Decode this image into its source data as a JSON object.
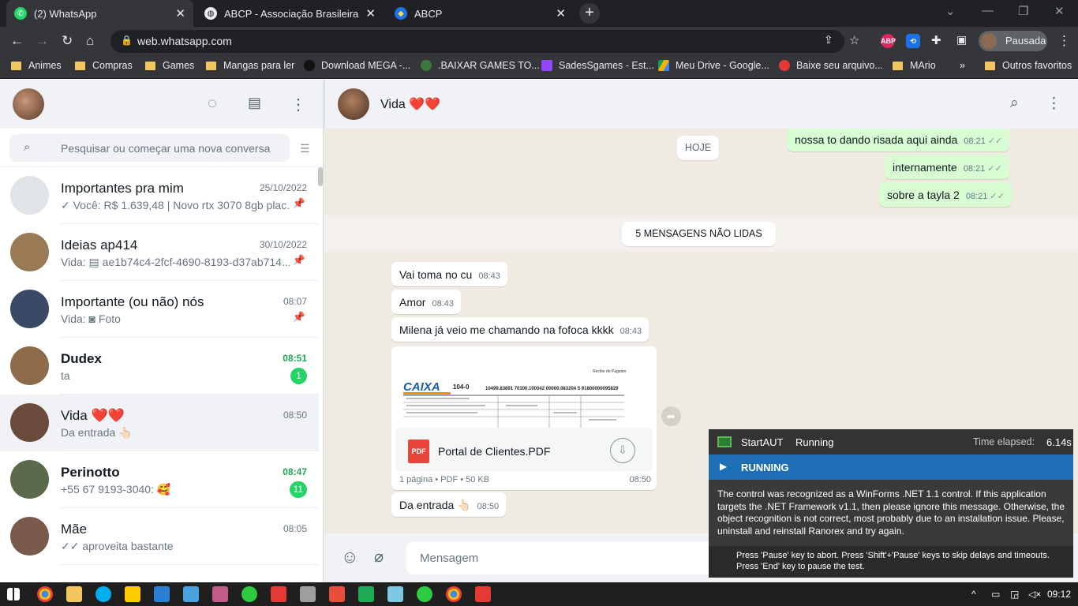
{
  "browser": {
    "tabs": [
      {
        "title": "(2) WhatsApp",
        "active": true
      },
      {
        "title": "ABCP - Associação Brasileira de Cimento",
        "active": false
      },
      {
        "title": "ABCP",
        "active": false
      }
    ],
    "url": "web.whatsapp.com",
    "profile_label": "Pausada",
    "extensions": [
      "ABP"
    ],
    "bookmarks": [
      "Animes",
      "Compras",
      "Games",
      "Mangas para ler",
      "Download MEGA -...",
      ".BAIXAR GAMES TO...",
      "SadesSgames - Est...",
      "Meu Drive - Google...",
      "Baixe seu arquivo...",
      "MArio",
      "Outros favoritos"
    ],
    "more_bookmarks": "»"
  },
  "whatsapp": {
    "search_placeholder": "Pesquisar ou começar uma nova conversa",
    "chats": [
      {
        "name": "Importantes pra mim",
        "time": "25/10/2022",
        "preview": "✓ Você: R$ 1.639,48 | Novo rtx 3070 8gb plac...",
        "pinned": true,
        "unread": null,
        "avatar_color": "#dfe5e7",
        "bold": false
      },
      {
        "name": "Ideias ap414",
        "time": "30/10/2022",
        "preview": "Vida: ▤ ae1b74c4-2fcf-4690-8193-d37ab714...",
        "pinned": true,
        "unread": null,
        "avatar_color": "#9a7a55",
        "bold": false
      },
      {
        "name": "Importante (ou não) nós",
        "time": "08:07",
        "preview": "Vida: ◙ Foto",
        "pinned": true,
        "unread": null,
        "avatar_color": "#3a4a66",
        "bold": false
      },
      {
        "name": "Dudex",
        "time": "08:51",
        "preview": "ta",
        "pinned": false,
        "unread": "1",
        "avatar_color": "#8c6a4a",
        "bold": true
      },
      {
        "name": "Vida ❤️❤️",
        "time": "08:50",
        "preview": "Da entrada 👆🏻",
        "pinned": false,
        "unread": null,
        "avatar_color": "#6a4a3a",
        "bold": false
      },
      {
        "name": "Perinotto",
        "time": "08:47",
        "preview": "+55 67 9193-3040: 🥰",
        "pinned": false,
        "unread": "11",
        "avatar_color": "#5a6a4a",
        "bold": true
      },
      {
        "name": "Mãe",
        "time": "08:05",
        "preview": "✓✓ aproveita bastante",
        "pinned": false,
        "unread": null,
        "avatar_color": "#7a5a4a",
        "bold": false
      }
    ],
    "active_chat": {
      "name": "Vida ❤️❤️",
      "date_pill": "HOJE",
      "unread_pill": "5 MENSAGENS NÃO LIDAS",
      "outgoing": [
        {
          "text": "nossa to dando risada aqui ainda",
          "time": "08:21"
        },
        {
          "text": "internamente",
          "time": "08:21"
        },
        {
          "text": "sobre a tayla 2",
          "time": "08:21"
        }
      ],
      "incoming": [
        {
          "text": "Vai toma no cu",
          "time": "08:43"
        },
        {
          "text": "Amor",
          "time": "08:43"
        },
        {
          "text": "Milena já veio me chamando na fofoca kkkk",
          "time": "08:43"
        }
      ],
      "document": {
        "name": "Portal de Clientes.PDF",
        "meta": "1 página • PDF • 50 KB",
        "time": "08:50",
        "preview_brand": "CAIXA",
        "preview_code": "104-0",
        "preview_line": "10499.83891 70100.100042 00000.083204 5 91800000095829",
        "preview_header": "Recibo do Pagador",
        "pdf_label": "PDF"
      },
      "last": {
        "text": "Da entrada 👆🏻",
        "time": "08:50"
      },
      "composer_placeholder": "Mensagem"
    }
  },
  "ranorex": {
    "app": "StartAUT",
    "status": "Running",
    "elapsed_label": "Time elapsed:",
    "elapsed": "6.14s",
    "band": "RUNNING",
    "message": "The control was recognized as a WinForms .NET 1.1 control. If this application targets the .NET Framework v1.1, then please ignore this message. Otherwise, the object recognition is not correct, most probably due to an installation issue. Please, uninstall and reinstall Ranorex and try again.",
    "keys_line1": "Press 'Pause' key to abort. Press 'Shift'+'Pause' keys to skip delays and timeouts.",
    "keys_line2": "Press 'End' key to pause the test."
  },
  "taskbar": {
    "clock": "09:12"
  }
}
